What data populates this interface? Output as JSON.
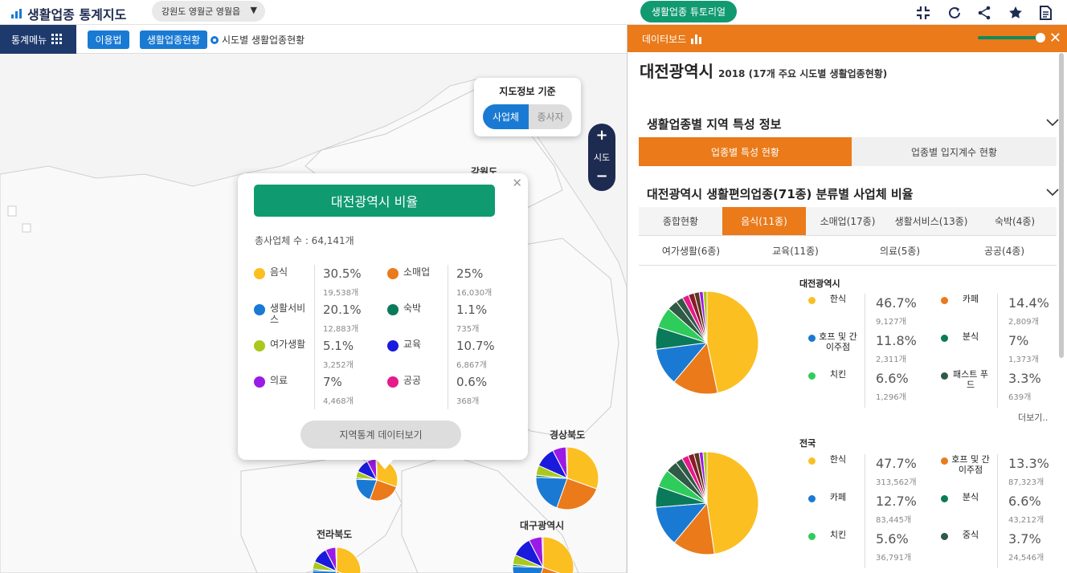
{
  "app": {
    "title": "생활업종 통계지도",
    "location": "강원도 영월군 영월읍",
    "tutorial": "생활업종 튜토리얼"
  },
  "toolbar": {
    "menu": "통계메뉴",
    "guide": "이용법",
    "status": "생활업종현황",
    "breadcrumb": "시도별 생활업종현황"
  },
  "basis": {
    "title": "지도정보 기준",
    "on": "사업체",
    "off": "종사자"
  },
  "zoom": {
    "label": "시도"
  },
  "popup": {
    "title": "대전광역시 비율",
    "total": "총사업체 수 : 64,141개",
    "items": [
      {
        "label": "음식",
        "pct": "30.5%",
        "count": "19,538개",
        "color": "#fbbf22"
      },
      {
        "label": "소매업",
        "pct": "25%",
        "count": "16,030개",
        "color": "#ea7a1a"
      },
      {
        "label": "생활서비스",
        "pct": "20.1%",
        "count": "12,883개",
        "color": "#1a7ad3"
      },
      {
        "label": "숙박",
        "pct": "1.1%",
        "count": "735개",
        "color": "#0a7a5a"
      },
      {
        "label": "여가생활",
        "pct": "5.1%",
        "count": "3,252개",
        "color": "#aac81e"
      },
      {
        "label": "교육",
        "pct": "10.7%",
        "count": "6,867개",
        "color": "#1a1adc"
      },
      {
        "label": "의료",
        "pct": "7%",
        "count": "4,468개",
        "color": "#9a1ae6"
      },
      {
        "label": "공공",
        "pct": "0.6%",
        "count": "368개",
        "color": "#e61a8a"
      }
    ],
    "button": "지역통계 데이터보기"
  },
  "map": {
    "labels": [
      "강원도",
      "경상북도",
      "전라북도",
      "대구광역시"
    ]
  },
  "panel": {
    "header": "데이터보드",
    "city": "대전광역시",
    "subtitle": "2018 (17개 주요 시도별 생활업종현황)",
    "section1": "생활업종별 지역 특성 정보",
    "tab_a": "업종별 특성 현황",
    "tab_b": "업종별 입지계수 현황",
    "section2": "대전광역시 생활편의업종(71종) 분류별 사업체 비율",
    "tabs1": [
      "종합현황",
      "음식(11종)",
      "소매업(17종)",
      "생활서비스(13종)",
      "숙박(4종)"
    ],
    "tabs2": [
      "여가생활(6종)",
      "교육(11종)",
      "의료(5종)",
      "공공(4종)"
    ],
    "more": "더보기..",
    "charts": [
      {
        "title": "대전광역시",
        "items": [
          {
            "label": "한식",
            "pct": "46.7%",
            "count": "9,127개",
            "color": "#fbbf22"
          },
          {
            "label": "카페",
            "pct": "14.4%",
            "count": "2,809개",
            "color": "#ea7a1a"
          },
          {
            "label": "호프 및 간이주점",
            "pct": "11.8%",
            "count": "2,311개",
            "color": "#1a7ad3"
          },
          {
            "label": "분식",
            "pct": "7%",
            "count": "1,373개",
            "color": "#0a7a5a"
          },
          {
            "label": "치킨",
            "pct": "6.6%",
            "count": "1,296개",
            "color": "#2ecc5a"
          },
          {
            "label": "패스트 푸드",
            "pct": "3.3%",
            "count": "639개",
            "color": "#2f5a45"
          }
        ]
      },
      {
        "title": "전국",
        "items": [
          {
            "label": "한식",
            "pct": "47.7%",
            "count": "313,562개",
            "color": "#fbbf22"
          },
          {
            "label": "호프 및 간이주점",
            "pct": "13.3%",
            "count": "87,323개",
            "color": "#ea7a1a"
          },
          {
            "label": "카페",
            "pct": "12.7%",
            "count": "83,445개",
            "color": "#1a7ad3"
          },
          {
            "label": "분식",
            "pct": "6.6%",
            "count": "43,212개",
            "color": "#0a7a5a"
          },
          {
            "label": "치킨",
            "pct": "5.6%",
            "count": "36,791개",
            "color": "#2ecc5a"
          },
          {
            "label": "중식",
            "pct": "3.7%",
            "count": "24,546개",
            "color": "#2f5a45"
          }
        ]
      }
    ]
  }
}
